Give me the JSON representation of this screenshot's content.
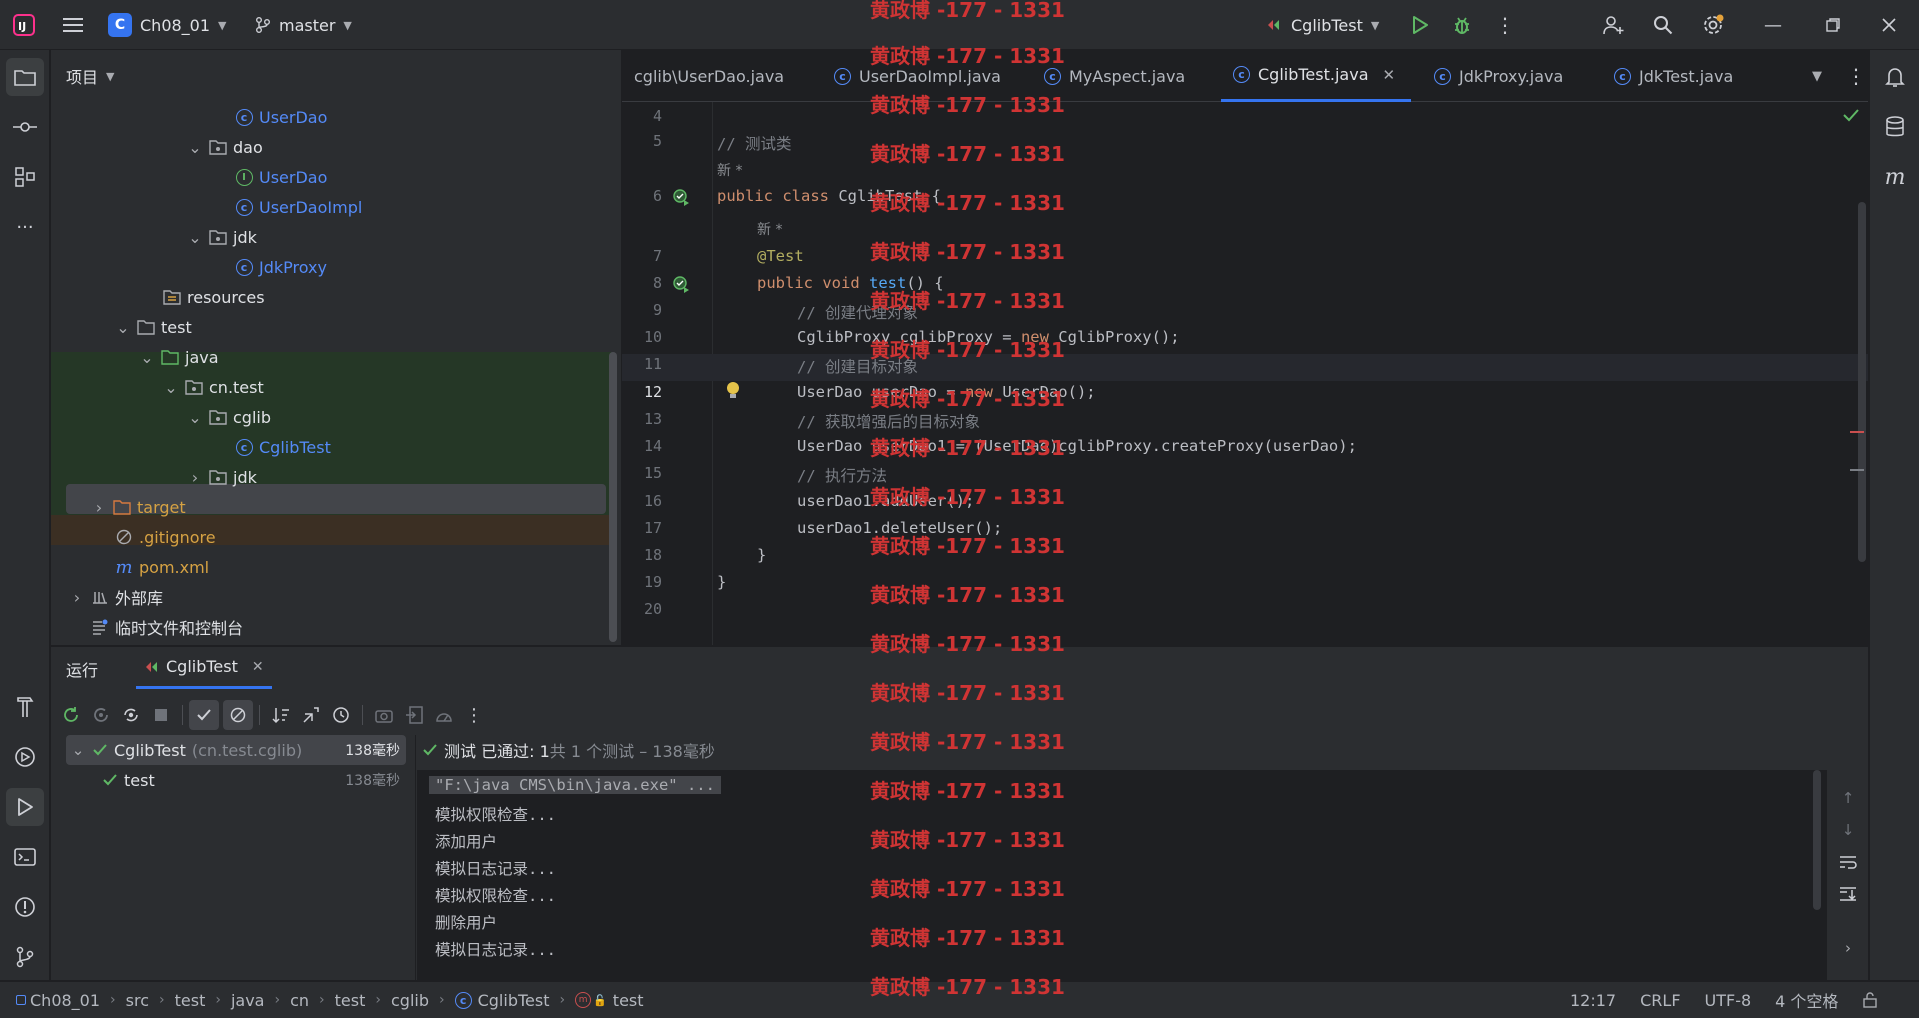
{
  "titlebar": {
    "project_initial": "C",
    "project_name": "Ch08_01",
    "branch": "master",
    "run_config": "CglibTest"
  },
  "project_panel": {
    "title": "项目",
    "rows": [
      {
        "label": "UserDao",
        "type": "class"
      },
      {
        "label": "dao",
        "type": "package"
      },
      {
        "label": "UserDao",
        "type": "interface"
      },
      {
        "label": "UserDaoImpl",
        "type": "class"
      },
      {
        "label": "jdk",
        "type": "package"
      },
      {
        "label": "JdkProxy",
        "type": "class"
      },
      {
        "label": "resources",
        "type": "resources"
      },
      {
        "label": "test",
        "type": "folder"
      },
      {
        "label": "java",
        "type": "testroot"
      },
      {
        "label": "cn.test",
        "type": "package"
      },
      {
        "label": "cglib",
        "type": "package"
      },
      {
        "label": "CglibTest",
        "type": "class"
      },
      {
        "label": "jdk",
        "type": "package"
      },
      {
        "label": "target",
        "type": "excluded"
      },
      {
        "label": ".gitignore",
        "type": "ignore"
      },
      {
        "label": "pom.xml",
        "type": "maven"
      },
      {
        "label": "外部库",
        "type": "library"
      },
      {
        "label": "临时文件和控制台",
        "type": "scratch"
      }
    ]
  },
  "editor_tabs": [
    {
      "label": "cglib\\UserDao.java"
    },
    {
      "label": "UserDaoImpl.java"
    },
    {
      "label": "MyAspect.java"
    },
    {
      "label": "CglibTest.java",
      "active": true
    },
    {
      "label": "JdkProxy.java"
    },
    {
      "label": "JdkTest.java"
    }
  ],
  "code": {
    "line_numbers": [
      "4",
      "5",
      "6",
      "7",
      "8",
      "9",
      "10",
      "11",
      "12",
      "13",
      "14",
      "15",
      "16",
      "17",
      "18",
      "19",
      "20"
    ],
    "hint_new": "新 *",
    "l5": "// 测试类",
    "l6a": "public class ",
    "l6b": "CglibTest {",
    "l7": "@Test",
    "l8a": "public void ",
    "l8b": "test",
    "l8c": "() {",
    "l9": "// 创建代理对象",
    "l10a": "CglibProxy cglibProxy = ",
    "l10b": "new",
    "l10c": " CglibProxy();",
    "l11": "// 创建目标对象",
    "l12a": "UserDao userDao = ",
    "l12b": "new",
    "l12c": " UserDao();",
    "l13": "// 获取增强后的目标对象",
    "l14": "UserDao userDao1 = (UserDao)cglibProxy.createProxy(userDao);",
    "l15": "// 执行方法",
    "l16": "userDao1.addUser();",
    "l17": "userDao1.deleteUser();",
    "l18": "}",
    "l19": "}"
  },
  "watermark": "黄政博 -177 - 1331",
  "run_panel": {
    "tab_run": "运行",
    "tab_config": "CglibTest",
    "tree_root_name": "CglibTest",
    "tree_root_pkg": "(cn.test.cglib)",
    "tree_root_time": "138毫秒",
    "tree_child_name": "test",
    "tree_child_time": "138毫秒",
    "summary_passed": "测试 已通过: 1",
    "summary_rest": "共 1 个测试 – 138毫秒",
    "console": [
      "\"F:\\java CMS\\bin\\java.exe\" ...",
      "模拟权限检查...",
      "添加用户",
      "模拟日志记录...",
      "模拟权限检查...",
      "删除用户",
      "模拟日志记录..."
    ]
  },
  "statusbar": {
    "crumbs": [
      "Ch08_01",
      "src",
      "test",
      "java",
      "cn",
      "test",
      "cglib",
      "CglibTest",
      "test"
    ],
    "position": "12:17",
    "line_sep": "CRLF",
    "encoding": "UTF-8",
    "indent": "4 个空格"
  }
}
